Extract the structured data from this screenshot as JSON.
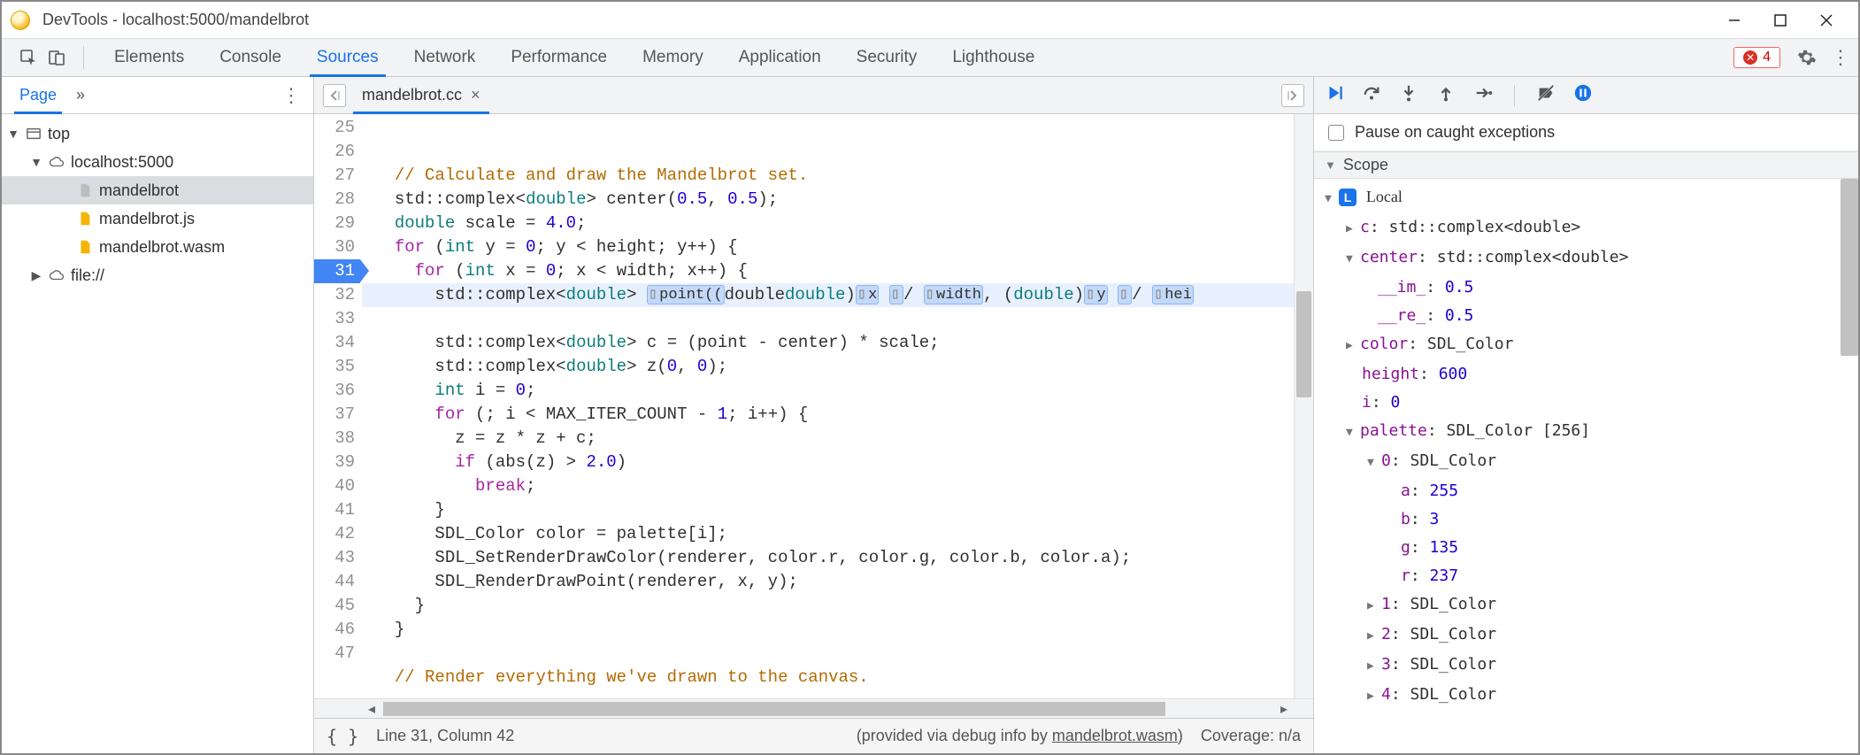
{
  "window": {
    "title": "DevTools - localhost:5000/mandelbrot"
  },
  "main_tabs": {
    "items": [
      "Elements",
      "Console",
      "Sources",
      "Network",
      "Performance",
      "Memory",
      "Application",
      "Security",
      "Lighthouse"
    ],
    "active": "Sources",
    "error_count": "4"
  },
  "page_panel": {
    "tab_label": "Page",
    "tree": {
      "top": "top",
      "host": "localhost:5000",
      "files": [
        "mandelbrot",
        "mandelbrot.js",
        "mandelbrot.wasm"
      ],
      "file_scheme": "file://"
    }
  },
  "editor": {
    "file_tab": "mandelbrot.cc",
    "gutter_start": 25,
    "breakpoint_line": 31,
    "lines": {
      "l26": "// Calculate and draw the Mandelbrot set.",
      "l27_a": "std",
      "l27_b": "::complex<",
      "l27_c": "double",
      "l27_d": "> center(",
      "l27_e": "0.5",
      "l27_f": ", ",
      "l27_g": "0.5",
      "l27_h": ");",
      "l28_a": "double",
      "l28_b": " scale = ",
      "l28_c": "4.0",
      "l28_d": ";",
      "l29_a": "for",
      "l29_b": " (",
      "l29_c": "int",
      "l29_d": " y = ",
      "l29_e": "0",
      "l29_f": "; y < height; y++) {",
      "l30_a": "for",
      "l30_b": " (",
      "l30_c": "int",
      "l30_d": " x = ",
      "l30_e": "0",
      "l30_f": "; x < width; x++) {",
      "l31_a": "std",
      "l31_b": "::complex<",
      "l31_c": "double",
      "l31_d": "> ",
      "l31_e": "point((",
      "l31_f": "double",
      "l31_g": ")",
      "l31_bx1": "x",
      "l31_sl1": "/ ",
      "l31_bx2": "width",
      "l31_mid": ", (",
      "l31_h": "double",
      "l31_i": ")",
      "l31_bx3": "y",
      "l31_sl2": "/ ",
      "l31_bx4": "hei",
      "l32_a": "std",
      "l32_b": "::complex<",
      "l32_c": "double",
      "l32_d": "> c = (point - center) * scale;",
      "l33_a": "std",
      "l33_b": "::complex<",
      "l33_c": "double",
      "l33_d": "> z(",
      "l33_e": "0",
      "l33_f": ", ",
      "l33_g": "0",
      "l33_h": ");",
      "l34_a": "int",
      "l34_b": " i = ",
      "l34_c": "0",
      "l34_d": ";",
      "l35_a": "for",
      "l35_b": " (; i < MAX_ITER_COUNT - ",
      "l35_c": "1",
      "l35_d": "; i++) {",
      "l36": "z = z * z + c;",
      "l37_a": "if",
      "l37_b": " (abs(z) > ",
      "l37_c": "2.0",
      "l37_d": ")",
      "l38_a": "break",
      "l38_b": ";",
      "l39": "}",
      "l40": "SDL_Color color = palette[i];",
      "l41": "SDL_SetRenderDrawColor(renderer, color.r, color.g, color.b, color.a);",
      "l42": "SDL_RenderDrawPoint(renderer, x, y);",
      "l43": "}",
      "l44": "}",
      "l45": "",
      "l46": "// Render everything we've drawn to the canvas."
    },
    "status": {
      "cursor": "Line 31, Column 42",
      "source_info_pre": "(provided via debug info by ",
      "source_info_link": "mandelbrot.wasm",
      "source_info_post": ")",
      "coverage": "Coverage: n/a"
    }
  },
  "debugger": {
    "pause_label": "Pause on caught exceptions",
    "scope_label": "Scope",
    "local_label": "Local",
    "vars": {
      "c": {
        "name": "c",
        "type": "std::complex<double>"
      },
      "center": {
        "name": "center",
        "type": "std::complex<double>",
        "im_k": "__im_",
        "im_v": "0.5",
        "re_k": "__re_",
        "re_v": "0.5"
      },
      "color": {
        "name": "color",
        "type": "SDL_Color"
      },
      "height": {
        "name": "height",
        "val": "600"
      },
      "i": {
        "name": "i",
        "val": "0"
      },
      "palette": {
        "name": "palette",
        "type": "SDL_Color [256]",
        "p0": {
          "idx": "0",
          "type": "SDL_Color",
          "a_k": "a",
          "a_v": "255",
          "b_k": "b",
          "b_v": "3",
          "g_k": "g",
          "g_v": "135",
          "r_k": "r",
          "r_v": "237"
        },
        "p1": {
          "idx": "1",
          "type": "SDL_Color"
        },
        "p2": {
          "idx": "2",
          "type": "SDL_Color"
        },
        "p3": {
          "idx": "3",
          "type": "SDL_Color"
        },
        "p4": {
          "idx": "4",
          "type": "SDL_Color"
        }
      }
    }
  }
}
